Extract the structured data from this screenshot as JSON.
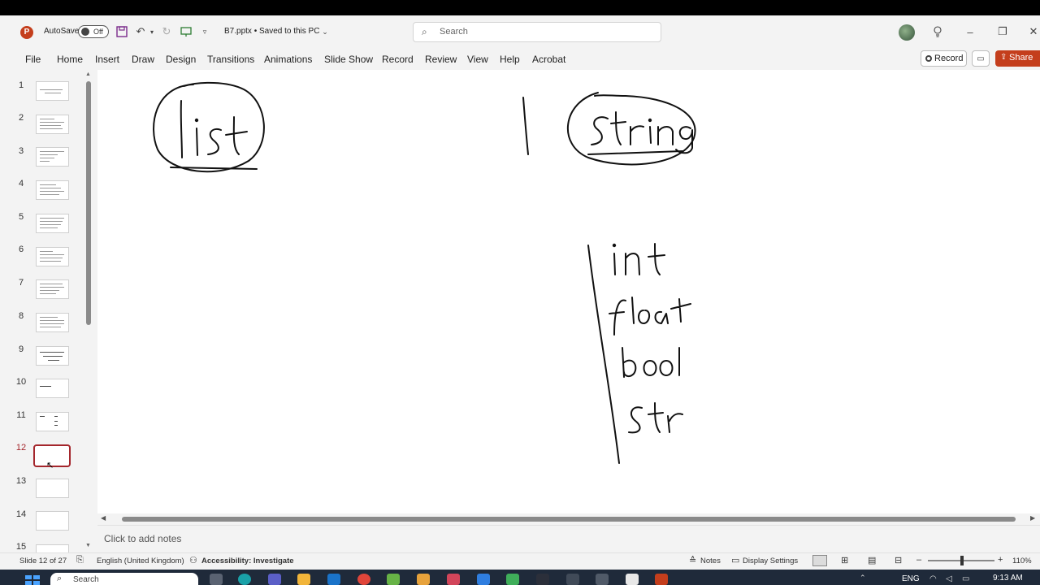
{
  "titlebar": {
    "autosave_label": "AutoSave",
    "autosave_state": "Off",
    "document_title": "B7.pptx • Saved to this PC",
    "search_placeholder": "Search"
  },
  "ribbon": {
    "tabs": [
      "File",
      "Home",
      "Insert",
      "Draw",
      "Design",
      "Transitions",
      "Animations",
      "Slide Show",
      "Record",
      "Review",
      "View",
      "Help",
      "Acrobat"
    ],
    "record_button": "Record",
    "share_button": "Share"
  },
  "thumbnails": {
    "numbers": [
      "1",
      "2",
      "3",
      "4",
      "5",
      "6",
      "7",
      "8",
      "9",
      "10",
      "11",
      "12",
      "13",
      "14",
      "15"
    ],
    "selected": "12"
  },
  "notes": {
    "placeholder": "Click to add notes"
  },
  "statusbar": {
    "slide_info": "Slide 12 of 27",
    "language": "English (United Kingdom)",
    "accessibility": "Accessibility: Investigate",
    "notes_label": "Notes",
    "display_settings": "Display Settings",
    "zoom": "110%"
  },
  "taskbar": {
    "search_placeholder": "Search",
    "language": "ENG",
    "time": "9:13 AM"
  },
  "colors": {
    "accent_red": "#c43e1c",
    "selected_thumb": "#a4262c"
  }
}
